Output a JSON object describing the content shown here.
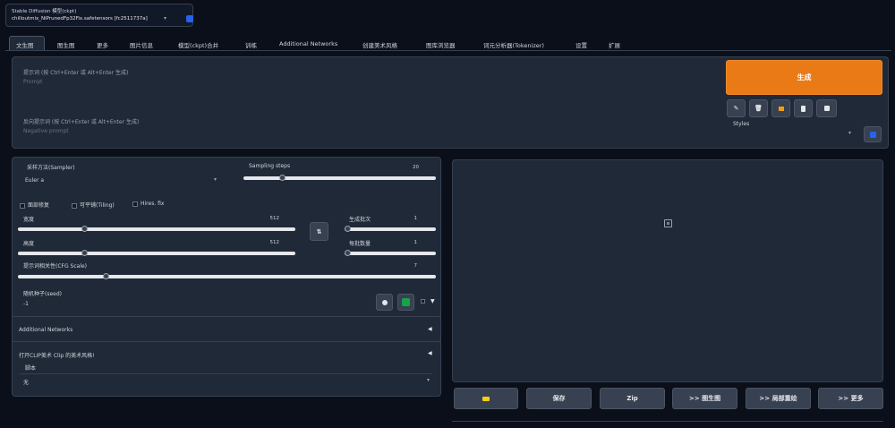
{
  "model": {
    "label": "Stable Diffusion 模型(ckpt)",
    "value": "chilloutmix_NiPrunedFp32Fix.safetensors [fc2511737a]"
  },
  "tabs": [
    "文生图",
    "图生图",
    "更多",
    "图片信息",
    "模型(ckpt)合并",
    "训练",
    "Additional Networks",
    "创建美术风格",
    "图库浏览器",
    "词元分析器(Tokenizer)",
    "设置",
    "扩展"
  ],
  "prompt": {
    "placeholder": "提示词 (按 Ctrl+Enter 或 Alt+Enter 生成)",
    "sub": "Prompt"
  },
  "negative_prompt": {
    "placeholder": "反向提示词 (按 Ctrl+Enter 或 Alt+Enter 生成)",
    "sub": "Negative prompt"
  },
  "generate_label": "生成",
  "styles_label": "Styles",
  "sampler": {
    "label": "采样方法(Sampler)",
    "value": "Euler a"
  },
  "steps": {
    "label": "Sampling steps",
    "value": "20",
    "fraction": 0.2
  },
  "checks": {
    "face": "面部修复",
    "tiling": "可平铺(Tiling)",
    "hires": "Hires. fix"
  },
  "width": {
    "label": "宽度",
    "value": "512",
    "fraction": 0.24
  },
  "height": {
    "label": "高度",
    "value": "512",
    "fraction": 0.24
  },
  "batch_count": {
    "label": "生成批次",
    "value": "1",
    "fraction": 0.0
  },
  "batch_size": {
    "label": "每批数量",
    "value": "1",
    "fraction": 0.0
  },
  "cfg": {
    "label": "提示词相关性(CFG Scale)",
    "value": "7",
    "fraction": 0.21
  },
  "seed": {
    "label": "随机种子(seed)",
    "value": "-1"
  },
  "additional_networks": "Additional Networks",
  "clip": {
    "label": "打开CLIP美术 Clip 的美术风格!",
    "sub_label": "脚本",
    "value": "无"
  },
  "actions": [
    "保存",
    "Zip",
    ">> 图生图",
    ">> 局部重绘",
    ">> 更多"
  ],
  "colors": {
    "accent": "#ea7a15",
    "blue": "#2563eb"
  }
}
